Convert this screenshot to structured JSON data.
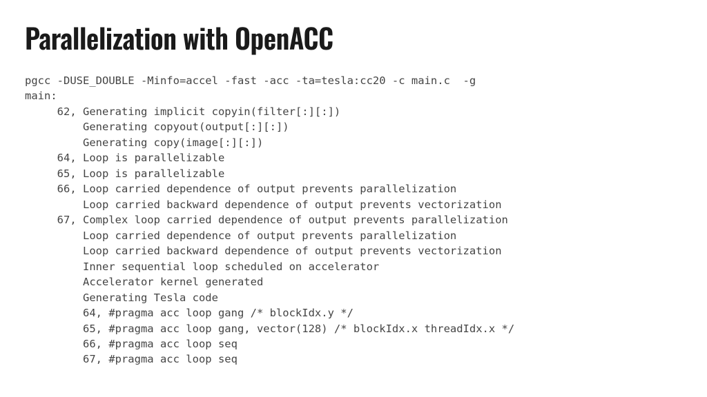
{
  "title": "Parallelization with OpenACC",
  "code_lines": [
    "pgcc -DUSE_DOUBLE -Minfo=accel -fast -acc -ta=tesla:cc20 -c main.c  -g",
    "main:",
    "     62, Generating implicit copyin(filter[:][:])",
    "         Generating copyout(output[:][:])",
    "         Generating copy(image[:][:])",
    "     64, Loop is parallelizable",
    "     65, Loop is parallelizable",
    "     66, Loop carried dependence of output prevents parallelization",
    "         Loop carried backward dependence of output prevents vectorization",
    "     67, Complex loop carried dependence of output prevents parallelization",
    "         Loop carried dependence of output prevents parallelization",
    "         Loop carried backward dependence of output prevents vectorization",
    "         Inner sequential loop scheduled on accelerator",
    "         Accelerator kernel generated",
    "         Generating Tesla code",
    "         64, #pragma acc loop gang /* blockIdx.y */",
    "         65, #pragma acc loop gang, vector(128) /* blockIdx.x threadIdx.x */",
    "         66, #pragma acc loop seq",
    "         67, #pragma acc loop seq"
  ]
}
